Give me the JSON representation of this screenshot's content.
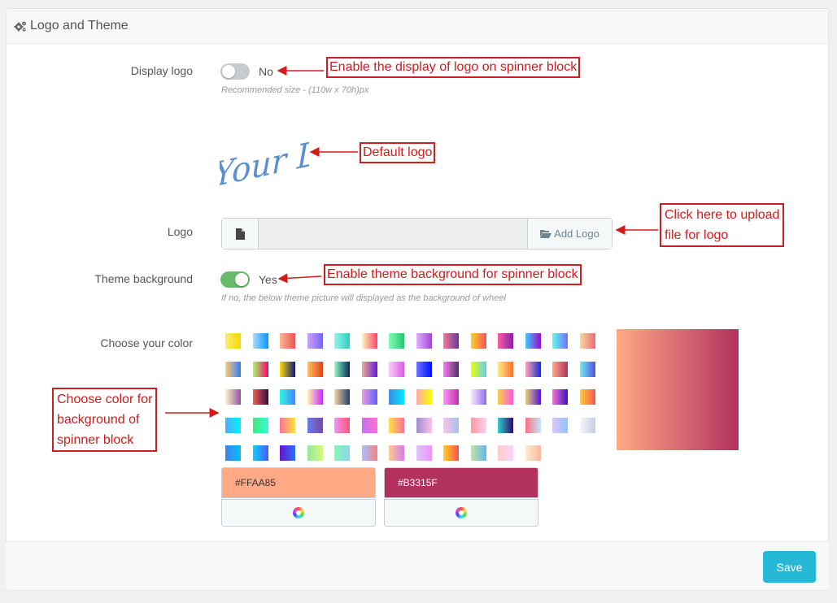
{
  "header": {
    "title": "Logo and Theme",
    "icon": "gear-icon"
  },
  "display_logo": {
    "label": "Display logo",
    "state": "No",
    "help": "Recommended size - (110w x 70h)px"
  },
  "default_logo_text": "Your Logo",
  "logo_field": {
    "label": "Logo",
    "button": "Add Logo",
    "value": ""
  },
  "theme_background": {
    "label": "Theme background",
    "state": "Yes",
    "help": "If no, the below theme picture will displayed as the background of wheel"
  },
  "color": {
    "label": "Choose your color",
    "from": "#FFAA85",
    "to": "#B3315F",
    "swatches": [
      [
        "#fdeb71",
        "#f8d800"
      ],
      [
        "#abdcff",
        "#0396ff"
      ],
      [
        "#feb692",
        "#ea5455"
      ],
      [
        "#ce9ffc",
        "#7367f0"
      ],
      [
        "#90f7ec",
        "#32ccbc"
      ],
      [
        "#fff6b7",
        "#f6416c"
      ],
      [
        "#81fbb8",
        "#28c76f"
      ],
      [
        "#e2b0ff",
        "#9f44d3"
      ],
      [
        "#f97794",
        "#623aa2"
      ],
      [
        "#fccf31",
        "#f55555"
      ],
      [
        "#f761a1",
        "#8c1bab"
      ],
      [
        "#43cbff",
        "#9708cc"
      ],
      [
        "#5efce8",
        "#736efe"
      ],
      [
        "#fad7a1",
        "#e96d71"
      ],
      [
        "#ffd26f",
        "#3677ff"
      ],
      [
        "#a0fe65",
        "#fa016d"
      ],
      [
        "#ffdb01",
        "#0e197d"
      ],
      [
        "#fec163",
        "#de4313"
      ],
      [
        "#92ffc0",
        "#002661"
      ],
      [
        "#eead92",
        "#6018dc"
      ],
      [
        "#f6cefc",
        "#e05be3"
      ],
      [
        "#6b73ff",
        "#000dff"
      ],
      [
        "#ff7af5",
        "#513162"
      ],
      [
        "#f0ff00",
        "#58cffb"
      ],
      [
        "#ffe985",
        "#fa742b"
      ],
      [
        "#ffa6b7",
        "#1e2ad2"
      ],
      [
        "#ffaa85",
        "#b3315f"
      ],
      [
        "#72edf2",
        "#5151e5"
      ],
      [
        "#fff5c3",
        "#9452a5"
      ],
      [
        "#f05f57",
        "#360940"
      ],
      [
        "#2afadf",
        "#4c83ff"
      ],
      [
        "#fff3b0",
        "#ca26ff"
      ],
      [
        "#ffd3a5",
        "#1e3c72"
      ],
      [
        "#ee9ae5",
        "#5961f9"
      ],
      [
        "#3c8ce7",
        "#00eaff"
      ],
      [
        "#ffa8a8",
        "#fcff00"
      ],
      [
        "#ff96f9",
        "#c32bac"
      ],
      [
        "#ffe6fa",
        "#8a6df5"
      ],
      [
        "#f6d242",
        "#ff52e5"
      ],
      [
        "#e8d07a",
        "#5312d6"
      ],
      [
        "#ff6fd8",
        "#3813c2"
      ],
      [
        "#fccf31",
        "#f55555"
      ],
      [
        "#4facfe",
        "#00f2fe"
      ],
      [
        "#43e97b",
        "#38f9d7"
      ],
      [
        "#fa709a",
        "#fee140"
      ],
      [
        "#667eea",
        "#764ba2"
      ],
      [
        "#f093fb",
        "#f5576c"
      ],
      [
        "#c471f5",
        "#fa71cd"
      ],
      [
        "#fee140",
        "#fa709a"
      ],
      [
        "#a18cd1",
        "#fbc2eb"
      ],
      [
        "#fbc2eb",
        "#a6c1ee"
      ],
      [
        "#ff9a9e",
        "#fecfef"
      ],
      [
        "#30cfd0",
        "#330867"
      ],
      [
        "#ff6e7f",
        "#bfe9ff"
      ],
      [
        "#e0c3fc",
        "#8ec5fc"
      ],
      [
        "#f5f7fa",
        "#c3cfe2"
      ],
      [
        "#4481eb",
        "#04befe"
      ],
      [
        "#0acffe",
        "#495aff"
      ],
      [
        "#6a11cb",
        "#2575fc"
      ],
      [
        "#96e6a1",
        "#d4fc79"
      ],
      [
        "#84fab0",
        "#8fd3f4"
      ],
      [
        "#a6c0fe",
        "#f68084"
      ],
      [
        "#fccb90",
        "#d57eeb"
      ],
      [
        "#e0c3fc",
        "#f093fb"
      ],
      [
        "#f9d423",
        "#ff4e50"
      ],
      [
        "#c2e59c",
        "#64b3f4"
      ],
      [
        "#fad0c4",
        "#ffd1ff"
      ],
      [
        "#ffecd2",
        "#fcb69f"
      ]
    ]
  },
  "annotations": {
    "display_logo": "Enable the display of logo on spinner block",
    "default_logo": "Default logo",
    "upload_1": "Click here to upload",
    "upload_2": "file for logo",
    "theme_bg": "Enable theme background for spinner block",
    "choose_1": "Choose color for",
    "choose_2": "background of",
    "choose_3": "spinner block"
  },
  "footer": {
    "save_label": "Save"
  }
}
